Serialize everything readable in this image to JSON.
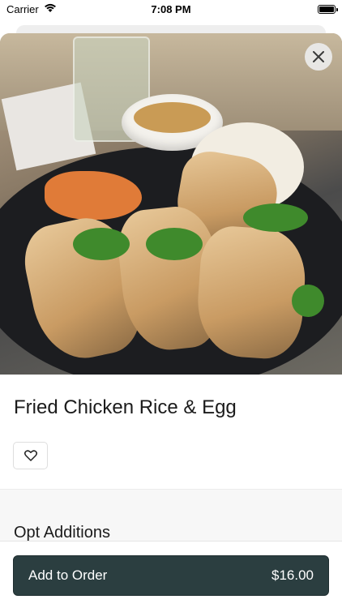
{
  "status_bar": {
    "carrier": "Carrier",
    "time": "7:08 PM"
  },
  "item": {
    "title": "Fried Chicken Rice & Egg",
    "image_alt": "Fried chicken with rice, egg, herbs and dipping sauce on a black plate"
  },
  "sections": {
    "additions_title": "Opt Additions"
  },
  "footer": {
    "add_label": "Add to Order",
    "price": "$16.00"
  },
  "colors": {
    "primary": "#2b3e40",
    "text": "#1b1b1b"
  },
  "icons": {
    "close": "close-icon",
    "favorite": "heart-icon",
    "wifi": "wifi-icon",
    "battery": "battery-icon"
  }
}
